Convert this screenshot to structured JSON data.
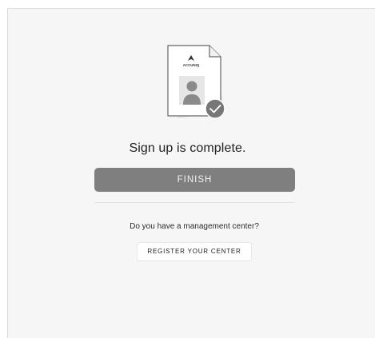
{
  "illustration": {
    "brand_text": "ACCUNIQ",
    "icons": [
      "document-icon",
      "accuniq-logo-icon",
      "person-icon",
      "check-circle-icon"
    ]
  },
  "main": {
    "title": "Sign up is complete.",
    "finish_label": "FINISH",
    "question": "Do you have a management center?",
    "register_label": "REGISTER YOUR CENTER"
  },
  "colors": {
    "background": "#f6f6f6",
    "finish_button": "#7f7f7f",
    "check_badge": "#777777"
  }
}
